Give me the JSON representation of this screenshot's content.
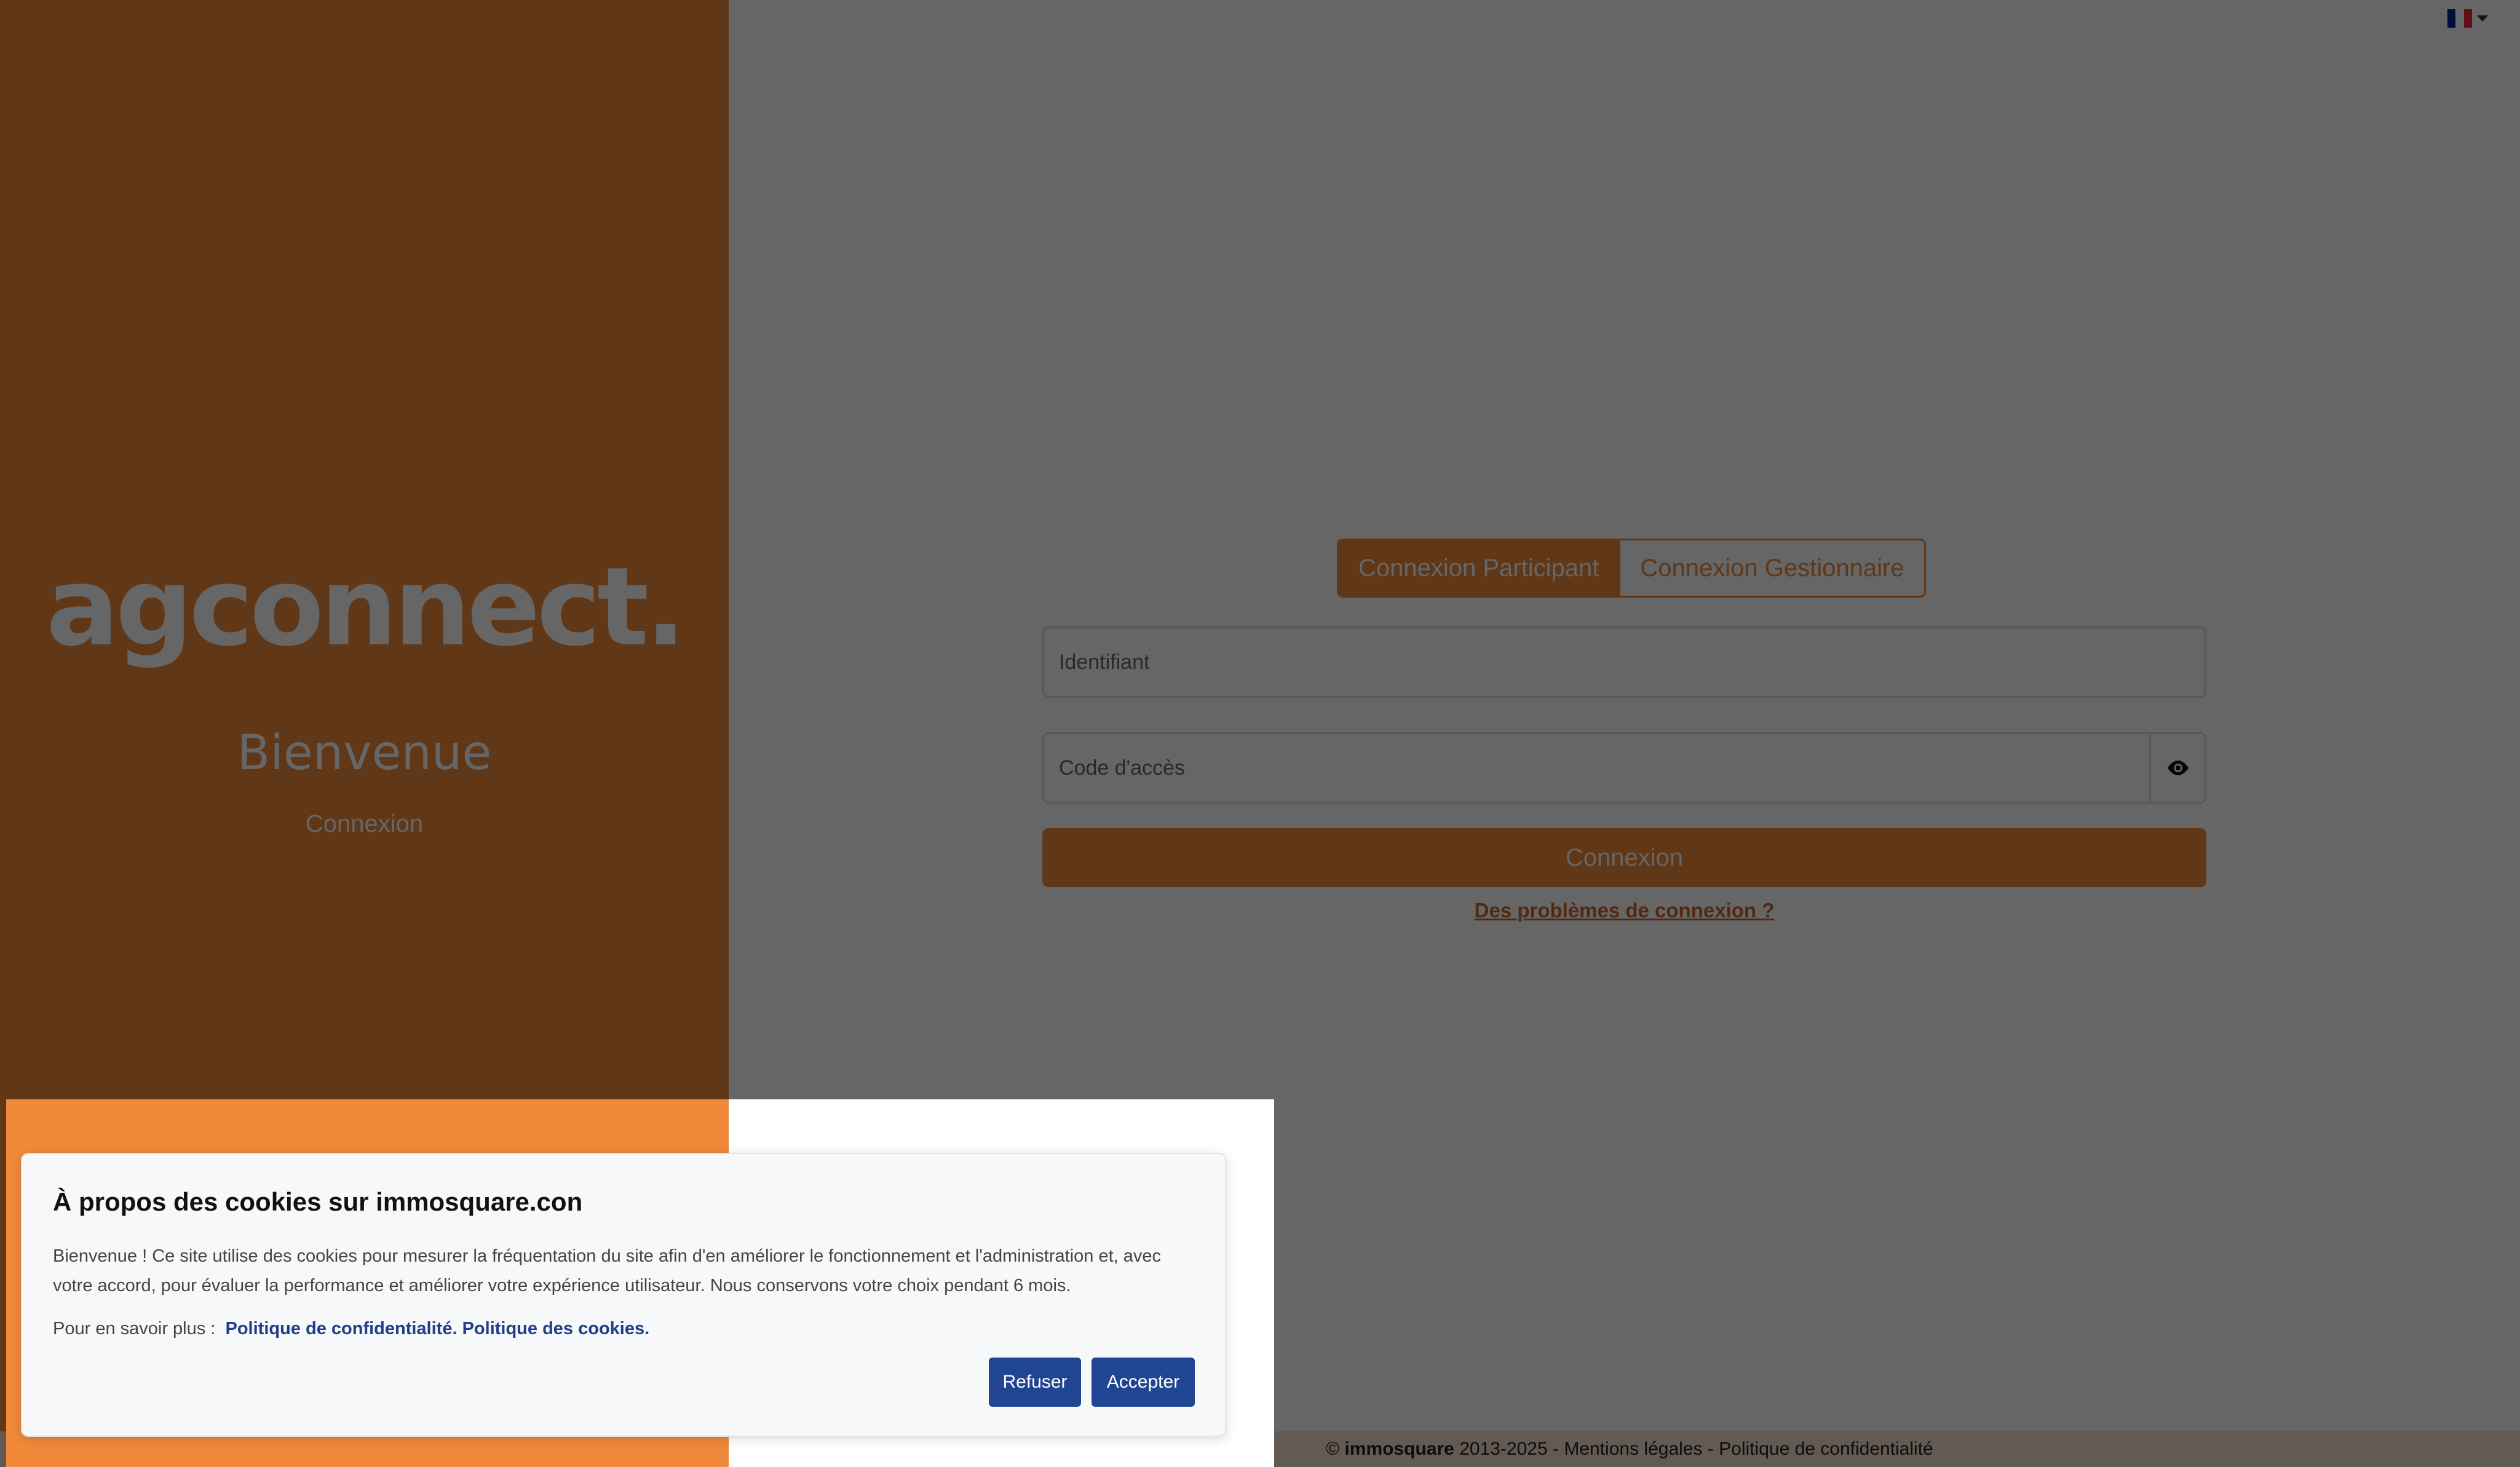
{
  "brand": {
    "logo": "agconnect.",
    "welcome": "Bienvenue",
    "subtitle": "Connexion"
  },
  "language": {
    "flag": "fr-flag-icon",
    "colors": [
      "#002395",
      "#ffffff",
      "#ed2939"
    ]
  },
  "login": {
    "tabs": [
      {
        "label": "Connexion Participant",
        "active": true
      },
      {
        "label": "Connexion Gestionnaire",
        "active": false
      }
    ],
    "identifier_placeholder": "Identifiant",
    "password_placeholder": "Code d'accès",
    "password_toggle_icon": "eye-icon",
    "submit_label": "Connexion",
    "help_link": "Des problèmes de connexion ?"
  },
  "footer": {
    "copyright_symbol": "©",
    "company": "immosquare",
    "years": "2013-2025",
    "separator": "-",
    "legal": "Mentions légales",
    "privacy": "Politique de confidentialité"
  },
  "cookie": {
    "title": "À propos des cookies sur immosquare.con",
    "body": "Bienvenue ! Ce site utilise des cookies pour mesurer la fréquentation du site afin d'en améliorer le fonctionnement et l'administration et, avec votre accord, pour évaluer la performance et améliorer votre expérience utilisateur. Nous conservons votre choix pendant 6 mois.",
    "learn_more": "Pour en savoir plus :",
    "privacy_link": "Politique de confidentialité.",
    "cookies_link": "Politique des cookies.",
    "refuse_label": "Refuser",
    "accept_label": "Accepter"
  },
  "colors": {
    "accent": "#f0893a",
    "link_blue": "#1f4593"
  }
}
